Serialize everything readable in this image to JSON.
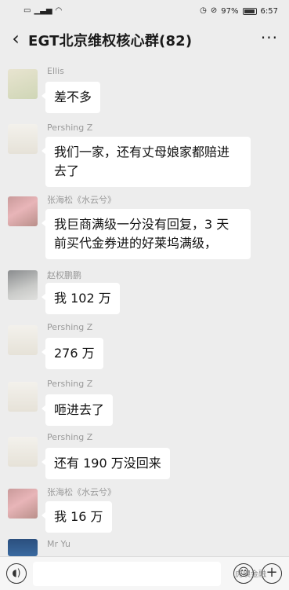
{
  "status_bar": {
    "left_icons": [
      "sim-icon",
      "signal-icon",
      "wifi-icon"
    ],
    "battery": "97%",
    "time": "6:57"
  },
  "header": {
    "back_icon": "‹",
    "title": "EGT北京维权核心群(82)",
    "more_icon": "···"
  },
  "messages": [
    {
      "sender": "Ellis",
      "text": "差不多"
    },
    {
      "sender": "Pershing Z",
      "lines": [
        "我们一家，还有丈母娘家都赔进",
        "去了"
      ]
    },
    {
      "sender": "张海松《水云兮》",
      "lines": [
        "我巨商满级一分没有回复，3 天",
        "前买代金券进的好莱坞满级，"
      ]
    },
    {
      "sender": "赵权鹏鹏",
      "text": "我 102 万"
    },
    {
      "sender": "Pershing Z",
      "text": "276 万"
    },
    {
      "sender": "Pershing Z",
      "text": "咂进去了"
    },
    {
      "sender": "Pershing Z",
      "text": "还有 190 万没回来"
    },
    {
      "sender": "张海松《水云兮》",
      "text": "我 16 万"
    },
    {
      "sender": "Mr Yu"
    }
  ],
  "input_bar": {
    "voice_icon": "voice-icon",
    "emoji_icon": "emoji-icon",
    "plus_icon": "plus-icon"
  },
  "watermark": "虎嗅金融"
}
